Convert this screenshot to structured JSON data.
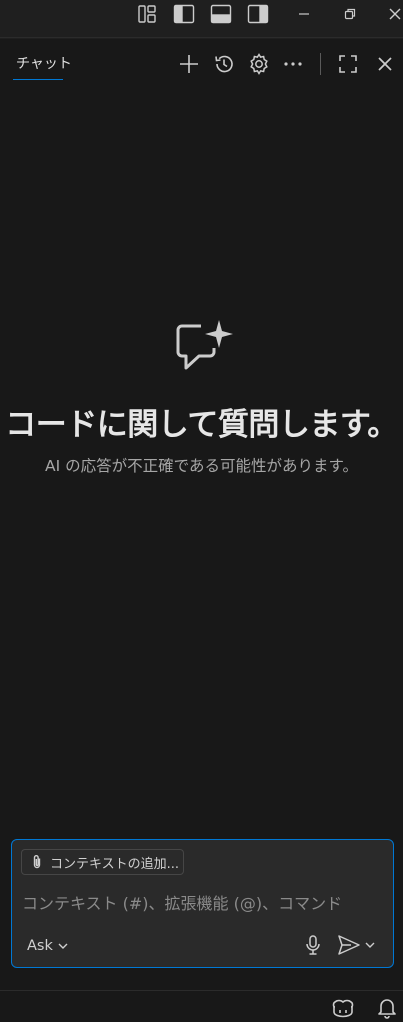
{
  "titlebar": {
    "icons": [
      "customize-layout-icon",
      "toggle-primary-sidebar-icon",
      "toggle-panel-icon",
      "toggle-secondary-sidebar-icon",
      "minimize-icon",
      "restore-icon",
      "close-icon"
    ]
  },
  "header": {
    "tab_label": "チャット",
    "actions": [
      "new-chat-icon",
      "history-icon",
      "settings-icon",
      "more-icon",
      "maximize-icon",
      "close-icon"
    ]
  },
  "welcome": {
    "title": "コードに関して質問します。",
    "subtitle": "AI の応答が不正確である可能性があります。"
  },
  "input": {
    "context_button_label": "コンテキストの追加...",
    "placeholder": "コンテキスト (#)、拡張機能 (@)、コマンド",
    "mode_label": "Ask"
  },
  "statusbar": {
    "icons": [
      "copilot-icon",
      "bell-icon"
    ]
  },
  "colors": {
    "accent": "#0078d4",
    "background": "#181818",
    "input_background": "#2a2a2a"
  }
}
